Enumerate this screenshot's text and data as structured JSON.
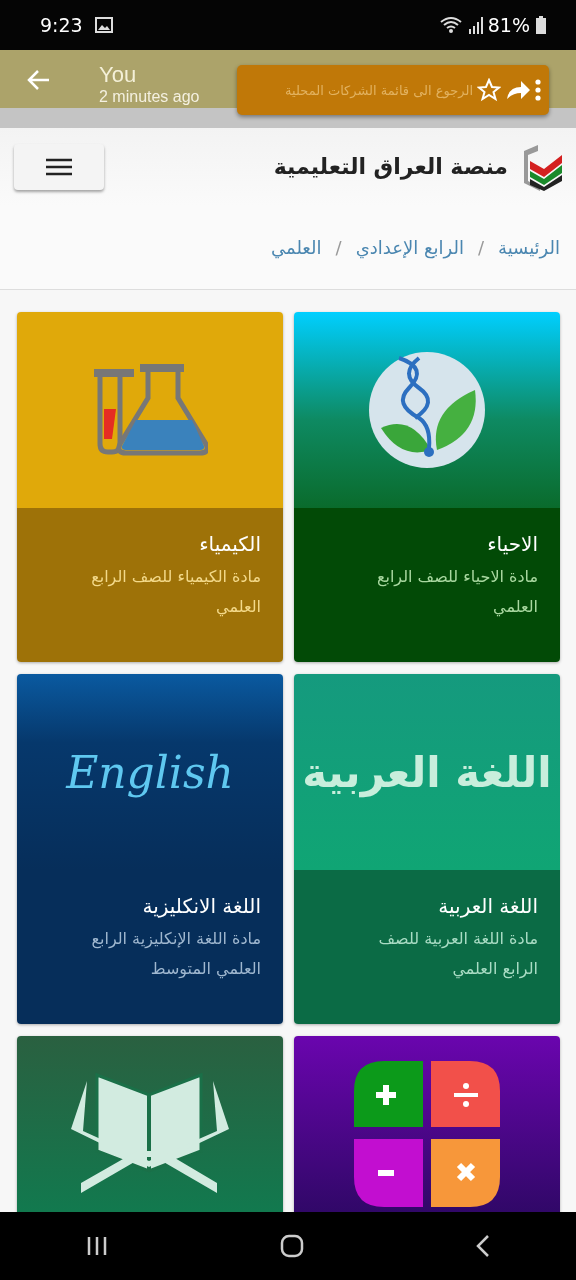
{
  "status_bar": {
    "time": "9:23",
    "battery": "81%"
  },
  "chat_header": {
    "title": "You",
    "subtitle": "2 minutes ago"
  },
  "banner": {
    "text": "الرجوع الى قائمة الشركات المحلية"
  },
  "app_header": {
    "title": "منصة العراق التعليمية"
  },
  "breadcrumb": [
    {
      "kind": "link",
      "text": "الرئيسية"
    },
    {
      "kind": "separator",
      "text": "/"
    },
    {
      "kind": "link",
      "text": "الرابع الإعدادي"
    },
    {
      "kind": "separator",
      "text": "/"
    },
    {
      "kind": "link",
      "text": "العلمي"
    }
  ],
  "cards": [
    {
      "kind": "biology",
      "title": "الاحياء",
      "description": "مادة الاحياء للصف الرابع العلمي"
    },
    {
      "kind": "chemistry",
      "title": "الكيمياء",
      "description": "مادة الكيمياء للصف الرابع العلمي"
    },
    {
      "kind": "arabic",
      "art_text": "اللغة العربية",
      "title": "اللغة العربية",
      "description": "مادة اللغة العربية للصف الرابع العلمي"
    },
    {
      "kind": "english",
      "art_text": "English",
      "title": "اللغة الانكليزية",
      "description": "مادة اللغة الإنكليزية الرابع العلمي المتوسط"
    },
    {
      "kind": "math"
    },
    {
      "kind": "quran"
    }
  ]
}
